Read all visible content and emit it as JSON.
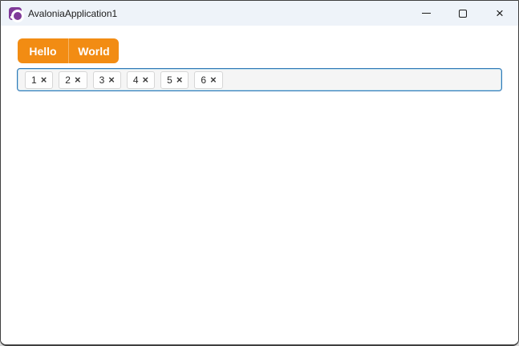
{
  "window": {
    "title": "AvaloniaApplication1",
    "icons": {
      "app": "avalonia-logo",
      "minimize": "minimize",
      "maximize": "maximize",
      "close": "×"
    }
  },
  "tabs": {
    "items": [
      {
        "label": "Hello"
      },
      {
        "label": "World"
      }
    ],
    "accent_color": "#F28C13"
  },
  "chip_input": {
    "focus_border_color": "#3279B7",
    "remove_icon": "×",
    "chips": [
      {
        "value": "1"
      },
      {
        "value": "2"
      },
      {
        "value": "3"
      },
      {
        "value": "4"
      },
      {
        "value": "5"
      },
      {
        "value": "6"
      }
    ]
  }
}
